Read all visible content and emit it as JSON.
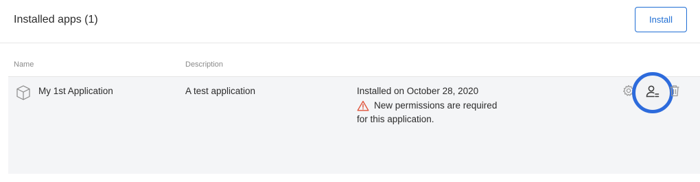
{
  "header": {
    "title": "Installed apps (1)",
    "install_label": "Install"
  },
  "table": {
    "columns": [
      "Name",
      "Description"
    ],
    "rows": [
      {
        "name": "My 1st Application",
        "description": "A test application",
        "status": "Installed on October 28, 2020",
        "warning_line1": "New permissions are required",
        "warning_line2": "for this application."
      }
    ]
  },
  "icons": {
    "app": "cube-icon",
    "warning": "warning-triangle-icon",
    "settings": "gear-icon",
    "permissions": "user-permissions-icon",
    "delete": "trash-icon"
  },
  "colors": {
    "accent": "#1f6ed4",
    "warning": "#e0533a",
    "row_bg": "#f4f5f7"
  }
}
